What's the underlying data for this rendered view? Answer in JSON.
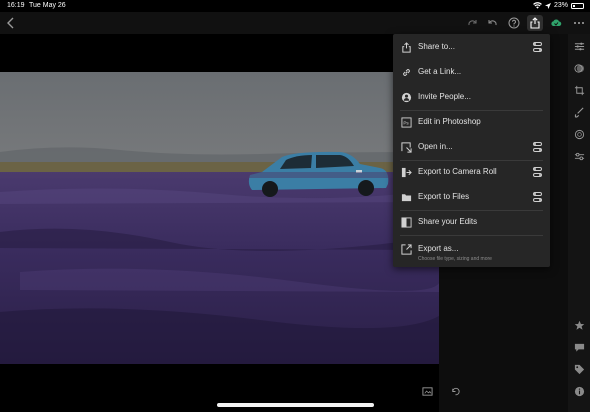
{
  "status_bar": {
    "time": "16:19",
    "date": "Tue May 26",
    "battery": "23%",
    "battery_level": 0.23,
    "icons": [
      "wifi-icon",
      "location-icon",
      "battery-icon"
    ]
  },
  "toolbar": {
    "icons": [
      "back-chevron-icon",
      "redo-icon",
      "undo-icon",
      "help-icon",
      "share-icon",
      "cloud-sync-icon",
      "more-icon"
    ]
  },
  "menu": {
    "items": [
      {
        "label": "Share to...",
        "icon": "share-to-icon",
        "toggle": true
      },
      {
        "label": "Get a Link...",
        "icon": "link-icon",
        "toggle": false
      },
      {
        "label": "Invite People...",
        "icon": "invite-people-icon",
        "toggle": false
      },
      {
        "label": "Edit in Photoshop",
        "icon": "photoshop-icon",
        "toggle": false
      },
      {
        "label": "Open in...",
        "icon": "open-in-icon",
        "toggle": true
      },
      {
        "label": "Export to Camera Roll",
        "icon": "camera-roll-icon",
        "toggle": true
      },
      {
        "label": "Export to Files",
        "icon": "folder-icon",
        "toggle": true
      },
      {
        "label": "Share your Edits",
        "icon": "share-edits-icon",
        "toggle": false
      },
      {
        "label": "Export as...",
        "sublabel": "Choose file type, sizing and more",
        "icon": "export-as-icon",
        "toggle": false
      }
    ]
  },
  "rail": {
    "top_icons": [
      "sliders-icon",
      "presets-icon",
      "crop-icon",
      "brush-icon",
      "radial-icon",
      "selective-icon"
    ],
    "bottom_icons": [
      "star-icon",
      "comment-icon",
      "tag-icon",
      "info-icon"
    ]
  },
  "photo": {
    "description_icons": [
      "compare-icon",
      "reset-icon"
    ],
    "colors": {
      "sky": "#6b7074",
      "lavender": "#3d2e63",
      "car": "#3b7ea5"
    }
  }
}
